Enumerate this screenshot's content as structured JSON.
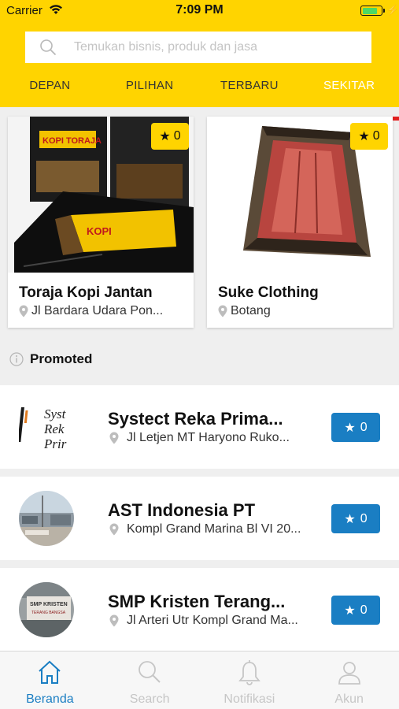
{
  "status_bar": {
    "carrier": "Carrier",
    "time": "7:09 PM",
    "battery_level": 0.85
  },
  "search": {
    "placeholder": "Temukan bisnis, produk dan jasa",
    "icon": "search-icon"
  },
  "top_tabs": [
    {
      "label": "DEPAN",
      "active": false
    },
    {
      "label": "PILIHAN",
      "active": false
    },
    {
      "label": "TERBARU",
      "active": false
    },
    {
      "label": "SEKITAR",
      "active": true
    }
  ],
  "featured": [
    {
      "title": "Toraja Kopi Jantan",
      "location": "Jl Bardara Udara Pon...",
      "rating": "0",
      "image": "coffee-bags-photo"
    },
    {
      "title": "Suke Clothing",
      "location": "Botang",
      "rating": "0",
      "image": "woven-textile-photo"
    }
  ],
  "promoted": {
    "label": "Promoted",
    "items": [
      {
        "title": "Systect Reka Prima...",
        "location": "Jl Letjen MT Haryono Ruko...",
        "rating": "0",
        "logo_text": [
          "Syst",
          "Rek",
          "Prir"
        ]
      },
      {
        "title": "AST Indonesia PT",
        "location": "Kompl Grand Marina Bl VI 20...",
        "rating": "0",
        "logo": "building-photo"
      },
      {
        "title": "SMP Kristen Terang...",
        "location": "Jl Arteri Utr Kompl Grand Ma...",
        "rating": "0",
        "logo_text": [
          "SMP KRISTEN",
          "TERANG BANGSA"
        ]
      }
    ]
  },
  "tabbar": [
    {
      "label": "Beranda",
      "icon": "home-icon",
      "active": true
    },
    {
      "label": "Search",
      "icon": "search-icon",
      "active": false
    },
    {
      "label": "Notifikasi",
      "icon": "bell-icon",
      "active": false
    },
    {
      "label": "Akun",
      "icon": "user-icon",
      "active": false
    }
  ],
  "colors": {
    "brand_yellow": "#ffd400",
    "accent_blue": "#1a7ec3",
    "inactive_gray": "#c6c6c6"
  }
}
